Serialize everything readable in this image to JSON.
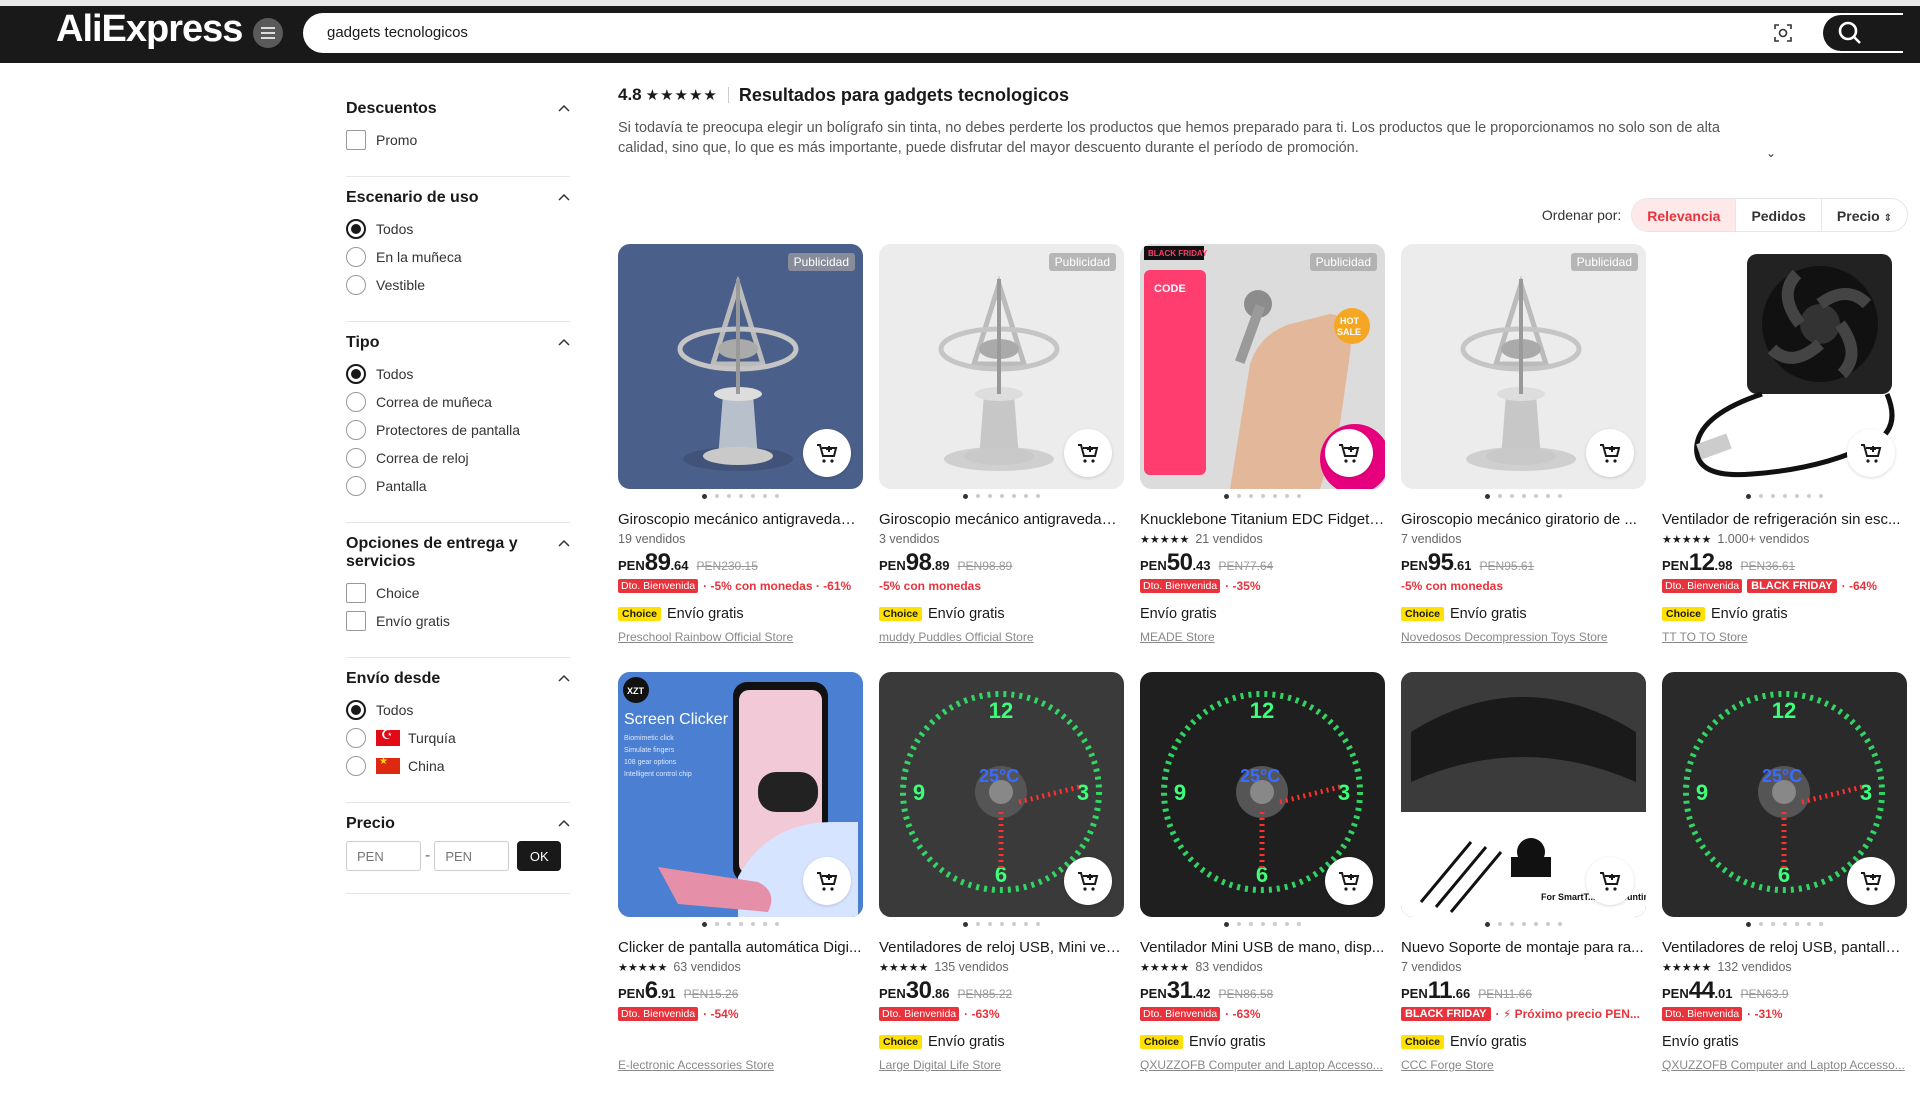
{
  "header": {
    "logo": "AliExpress",
    "search_value": "gadgets tecnologicos"
  },
  "sidebar": {
    "groups": [
      {
        "title": "Descuentos",
        "type": "checkbox",
        "options": [
          "Promo"
        ]
      },
      {
        "title": "Escenario de uso",
        "type": "radio",
        "options": [
          "Todos",
          "En la muñeca",
          "Vestible"
        ],
        "selected": 0
      },
      {
        "title": "Tipo",
        "type": "radio",
        "options": [
          "Todos",
          "Correa de muñeca",
          "Protectores de pantalla",
          "Correa de reloj",
          "Pantalla"
        ],
        "selected": 0
      },
      {
        "title": "Opciones de entrega y servicios",
        "type": "checkbox",
        "options": [
          "Choice",
          "Envío gratis"
        ]
      },
      {
        "title": "Envío desde",
        "type": "radio",
        "options": [
          "Todos",
          "Turquía",
          "China"
        ],
        "selected": 0
      }
    ],
    "price": {
      "title": "Precio",
      "min_placeholder": "PEN",
      "max_placeholder": "PEN",
      "ok": "OK"
    }
  },
  "results": {
    "rating": "4.8",
    "title": "Resultados para gadgets tecnologicos",
    "description": "Si todavía te preocupa elegir un bolígrafo sin tinta, no debes perderte los productos que hemos preparado para ti. Los productos que le proporcionamos no solo son de alta calidad, sino que, lo que es más importante, puede disfrutar del mayor descuento durante el período de promoción."
  },
  "sort": {
    "label": "Ordenar por:",
    "tabs": [
      "Relevancia",
      "Pedidos",
      "Precio"
    ],
    "active": "Relevancia"
  },
  "products": [
    {
      "title": "Giroscopio mecánico antigravedad ...",
      "stars": false,
      "sold": "19 vendidos",
      "cur": "PEN",
      "int": "89",
      "dec": ".64",
      "old": "PEN230.15",
      "badge": "Dto. Bienvenida",
      "promo": "· -5% con monedas · -61%",
      "choice": true,
      "ship": "Envío gratis",
      "store": "Preschool Rainbow Official Store",
      "ad": "Publicidad",
      "img": "gyro1"
    },
    {
      "title": "Giroscopio mecánico antigravedad ...",
      "stars": false,
      "sold": "3 vendidos",
      "cur": "PEN",
      "int": "98",
      "dec": ".89",
      "old": "PEN98.89",
      "badge": "",
      "promo": "-5% con monedas",
      "choice": true,
      "ship": "Envío gratis",
      "store": "muddy Puddles Official Store",
      "ad": "Publicidad",
      "img": "gyro2"
    },
    {
      "title": "Knucklebone Titanium EDC Fidget ...",
      "stars": true,
      "sold": "21 vendidos",
      "cur": "PEN",
      "int": "50",
      "dec": ".43",
      "old": "PEN77.64",
      "badge": "Dto. Bienvenida",
      "promo": "· -35%",
      "choice": false,
      "ship": "Envío gratis",
      "store": "MEADE Store",
      "ad": "Publicidad",
      "img": "knuckle"
    },
    {
      "title": "Giroscopio mecánico giratorio de ...",
      "stars": false,
      "sold": "7 vendidos",
      "cur": "PEN",
      "int": "95",
      "dec": ".61",
      "old": "PEN95.61",
      "badge": "",
      "promo": "-5% con monedas",
      "choice": true,
      "ship": "Envío gratis",
      "store": "Novedosos Decompression Toys Store",
      "ad": "Publicidad",
      "img": "gyro3"
    },
    {
      "title": "Ventilador de refrigeración sin esc...",
      "stars": true,
      "sold": "1.000+ vendidos",
      "cur": "PEN",
      "int": "12",
      "dec": ".98",
      "old": "PEN36.61",
      "badge": "Dto. Bienvenida",
      "bf": "BLACK FRIDAY",
      "promo": "· -64%",
      "choice": true,
      "ship": "Envío gratis",
      "store": "TT TO TO Store",
      "ad": "",
      "img": "fan"
    },
    {
      "title": "Clicker de pantalla automática Digi...",
      "stars": true,
      "sold": "63 vendidos",
      "cur": "PEN",
      "int": "6",
      "dec": ".91",
      "old": "PEN15.26",
      "badge": "Dto. Bienvenida",
      "promo": "· -54%",
      "choice": false,
      "ship": "",
      "store": "E-lectronic Accessories Store",
      "ad": "",
      "img": "clicker"
    },
    {
      "title": "Ventiladores de reloj USB, Mini ven...",
      "stars": true,
      "sold": "135 vendidos",
      "cur": "PEN",
      "int": "30",
      "dec": ".86",
      "old": "PEN85.22",
      "badge": "Dto. Bienvenida",
      "promo": "· -63%",
      "choice": true,
      "ship": "Envío gratis",
      "store": "Large Digital Life Store",
      "ad": "",
      "img": "clockfan1"
    },
    {
      "title": "Ventilador Mini USB de mano, disp...",
      "stars": true,
      "sold": "83 vendidos",
      "cur": "PEN",
      "int": "31",
      "dec": ".42",
      "old": "PEN86.58",
      "badge": "Dto. Bienvenida",
      "promo": "· -63%",
      "choice": true,
      "ship": "Envío gratis",
      "store": "QXUZZOFB Computer and Laptop Accesso...",
      "ad": "",
      "img": "clockfan2"
    },
    {
      "title": "Nuevo Soporte de montaje para ra...",
      "stars": false,
      "sold": "7 vendidos",
      "cur": "PEN",
      "int": "11",
      "dec": ".66",
      "old": "PEN11.66",
      "badge": "",
      "bf": "BLACK FRIDAY",
      "promo": "· ⚡ Próximo precio PEN...",
      "choice": true,
      "ship": "Envío gratis",
      "store": "CCC Forge Store",
      "ad": "",
      "img": "mount"
    },
    {
      "title": "Ventiladores de reloj USB, pantalla ...",
      "stars": true,
      "sold": "132 vendidos",
      "cur": "PEN",
      "int": "44",
      "dec": ".01",
      "old": "PEN63.9",
      "badge": "Dto. Bienvenida",
      "promo": "· -31%",
      "choice": false,
      "ship": "Envío gratis",
      "store": "QXUZZOFB Computer and Laptop Accesso...",
      "ad": "",
      "img": "clockfan3"
    }
  ],
  "image_labels": {
    "knuckle_black_friday": "BLACK FRIDAY",
    "knuckle_code": "CODE",
    "knuckle_hot": "HOT SALE",
    "clicker_brand": "XZT",
    "clicker_title": "Screen Clicker",
    "clicker_lines": [
      "Biomimetic click",
      "Simulate fingers",
      "108 gear options",
      "Intelligent control chip"
    ],
    "mount_caption": "For SmartT... ker Mounting Bracket"
  }
}
